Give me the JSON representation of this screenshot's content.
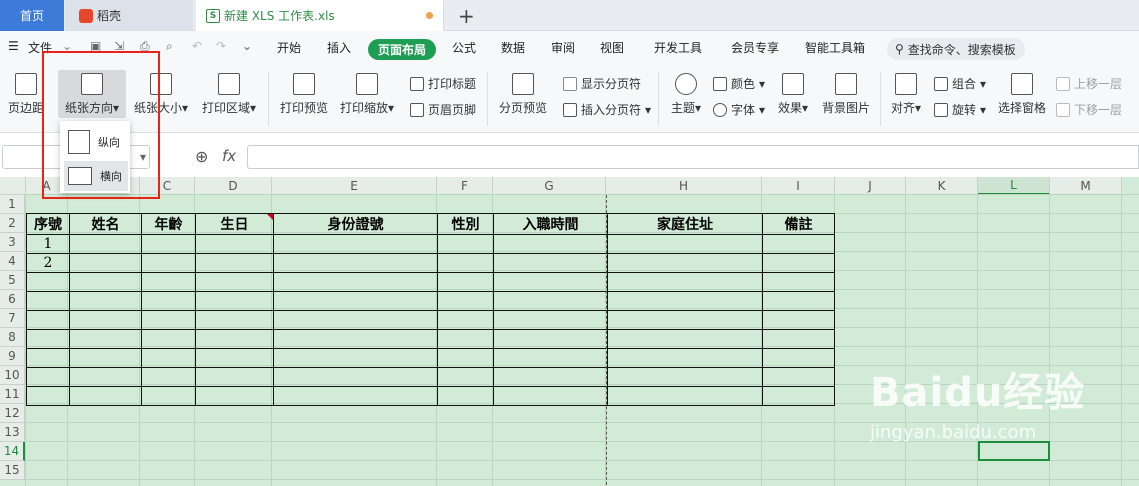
{
  "tabs": {
    "home": "首页",
    "daoke": "稻壳",
    "doc": "新建 XLS 工作表.xls",
    "doc_icon": "S"
  },
  "menu": {
    "file": "文件",
    "items": [
      "开始",
      "插入",
      "页面布局",
      "公式",
      "数据",
      "审阅",
      "视图",
      "开发工具",
      "会员专享",
      "智能工具箱"
    ],
    "active": "页面布局",
    "search": "查找命令、搜索模板"
  },
  "ribbon": {
    "margins": "页边距",
    "orientation": "纸张方向",
    "size": "纸张大小",
    "print_area": "打印区域",
    "print_preview": "打印预览",
    "print_scale": "打印缩放",
    "print_titles": "打印标题",
    "header_footer": "页眉页脚",
    "page_break_preview": "分页预览",
    "show_page_breaks": "显示分页符",
    "insert_page_break": "插入分页符",
    "theme": "主题",
    "color": "颜色",
    "font": "字体",
    "effects": "效果",
    "bg_image": "背景图片",
    "align": "对齐",
    "group": "组合",
    "rotate": "旋转",
    "selection_pane": "选择窗格",
    "bring_forward": "上移一层",
    "send_backward": "下移一层"
  },
  "orientation_menu": {
    "portrait": "纵向",
    "landscape": "横向"
  },
  "formula_bar": {
    "fx": "fx"
  },
  "columns": [
    "A",
    "B",
    "C",
    "D",
    "E",
    "F",
    "G",
    "H",
    "I",
    "J",
    "K",
    "L",
    "M"
  ],
  "rows": [
    "1",
    "2",
    "3",
    "4",
    "5",
    "6",
    "7",
    "8",
    "9",
    "10",
    "11",
    "12",
    "13",
    "14",
    "15"
  ],
  "sheet": {
    "headers": [
      "序號",
      "姓名",
      "年齡",
      "生日",
      "身份證號",
      "性別",
      "入職時間",
      "家庭住址",
      "備註"
    ],
    "serials": [
      "1",
      "2"
    ]
  },
  "watermark": {
    "brand": "Baidu经验",
    "url": "jingyan.baidu.com"
  },
  "colors": {
    "accent": "#1e9e54",
    "highlight": "#e8231a",
    "grid_bg": "#d2ebd6"
  }
}
